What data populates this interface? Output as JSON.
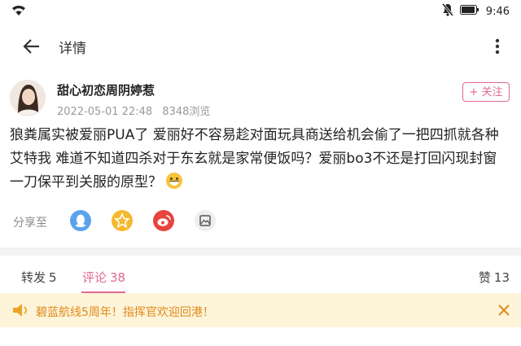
{
  "status_bar": {
    "time": "9:46",
    "icons": [
      "wifi-icon",
      "mute-icon",
      "battery-icon"
    ]
  },
  "header": {
    "title": "详情",
    "back_icon": "back-arrow-icon",
    "more_icon": "more-vertical-icon"
  },
  "post": {
    "author": "甜心初恋周阴婷惹",
    "date": "2022-05-01 22:48",
    "views": "8348浏览",
    "follow_label": "+ 关注",
    "content": "狼粪属实被爱丽PUA了 爱丽好不容易趁对面玩具商送给机会偷了一把四抓就各种艾特我 难道不知道四杀对于东玄就是家常便饭吗？爱丽bo3不还是打回闪现封窗一刀保平到关服的原型？",
    "emoji": "grinning-sweat-emoji"
  },
  "share": {
    "label": "分享至",
    "targets": [
      {
        "name": "qq-icon",
        "color": "#5aa3ec"
      },
      {
        "name": "qzone-icon",
        "color": "#f5b82e"
      },
      {
        "name": "weibo-icon",
        "color": "#e8443d"
      },
      {
        "name": "image-save-icon",
        "color": "#eeeeee"
      }
    ]
  },
  "tabs": {
    "repost_label": "转发",
    "repost_count": "5",
    "comment_label": "评论",
    "comment_count": "38",
    "like_label": "赞",
    "like_count": "13"
  },
  "banner": {
    "text": "碧蓝航线5周年！指挥官欢迎回港！",
    "icon": "speaker-icon",
    "close_icon": "close-icon"
  },
  "colors": {
    "accent": "#e06a8d",
    "banner_bg": "#fdf4d9",
    "banner_text": "#e08a1a"
  }
}
